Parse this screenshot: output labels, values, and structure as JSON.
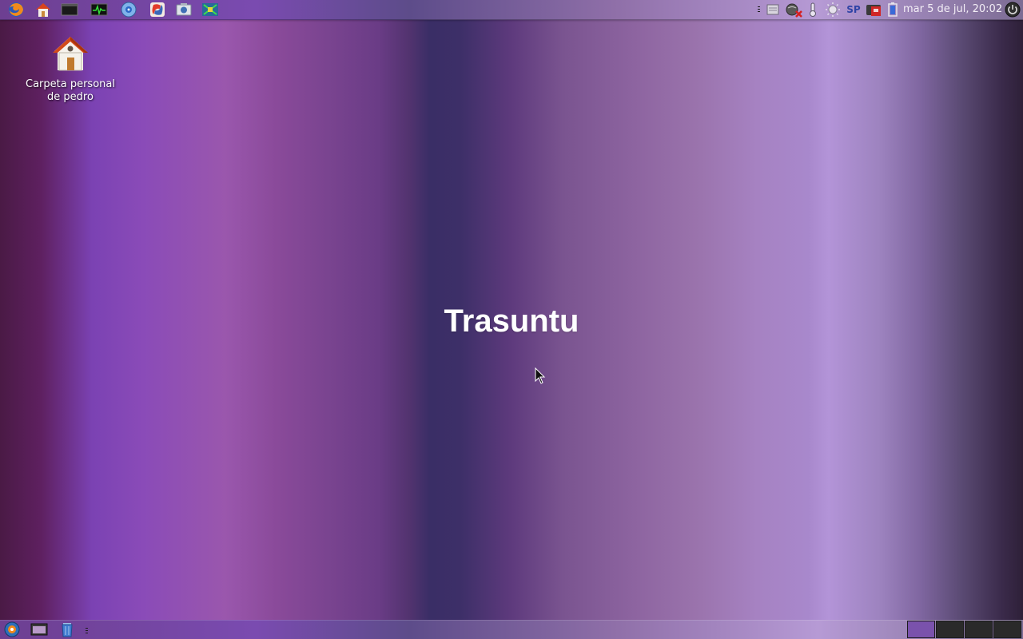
{
  "top_panel": {
    "launchers": [
      {
        "icon": "firefox-icon"
      },
      {
        "icon": "home-folder-icon"
      },
      {
        "icon": "terminal-icon"
      },
      {
        "icon": "system-monitor-icon"
      },
      {
        "icon": "disc-burner-icon"
      },
      {
        "icon": "python-icon"
      },
      {
        "icon": "screenshot-icon"
      },
      {
        "icon": "network-tool-icon"
      }
    ],
    "tray": {
      "keyboard_layout": "SP",
      "clock": "mar  5 de jul, 20:02"
    }
  },
  "desktop": {
    "icons": [
      {
        "label": "Carpeta personal de pedro",
        "icon": "home-folder-icon"
      }
    ],
    "wallpaper_text": "Trasuntu"
  },
  "bottom_panel": {
    "workspaces": {
      "count": 4,
      "active_index": 0,
      "active_color": "#7a52ac",
      "inactive_color": "#2a2a2a"
    }
  }
}
